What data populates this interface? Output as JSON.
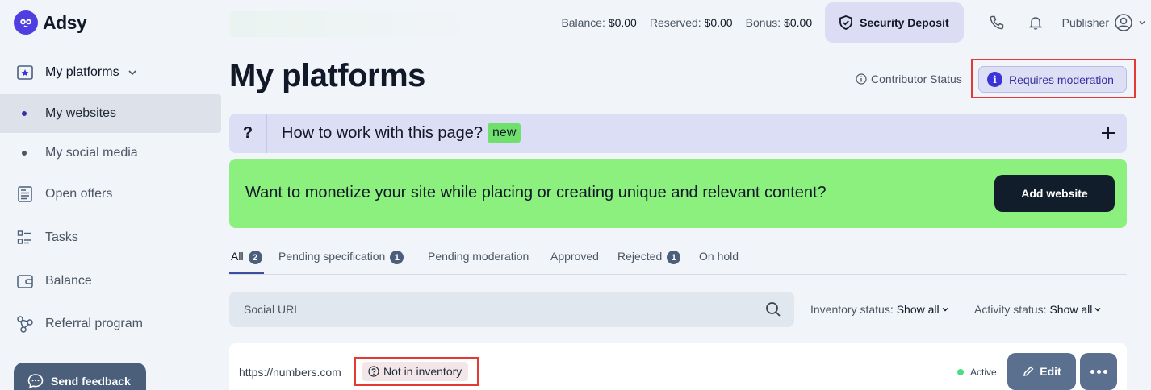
{
  "app": {
    "name": "Adsy"
  },
  "header": {
    "balance_label": "Balance:",
    "balance_value": "$0.00",
    "reserved_label": "Reserved:",
    "reserved_value": "$0.00",
    "bonus_label": "Bonus:",
    "bonus_value": "$0.00",
    "deposit_label": "Security Deposit",
    "user_label": "Publisher"
  },
  "sidebar": {
    "items": [
      {
        "label": "My platforms",
        "icon": "star-browser-icon"
      },
      {
        "label": "My websites"
      },
      {
        "label": "My social media"
      },
      {
        "label": "Open offers",
        "icon": "document-icon"
      },
      {
        "label": "Tasks",
        "icon": "checklist-icon"
      },
      {
        "label": "Balance",
        "icon": "wallet-icon"
      },
      {
        "label": "Referral program",
        "icon": "share-icon"
      }
    ],
    "feedback_label": "Send feedback"
  },
  "main": {
    "title": "My platforms",
    "contributor_label": "Contributor Status",
    "contributor_status": "Requires moderation",
    "howto": {
      "q": "?",
      "text": "How to work with this page?",
      "badge": "new"
    },
    "banner": {
      "text": "Want to monetize your site while placing or creating unique and relevant content?",
      "button": "Add website"
    },
    "tabs": [
      {
        "label": "All",
        "count": "2"
      },
      {
        "label": "Pending specification",
        "count": "1"
      },
      {
        "label": "Pending moderation"
      },
      {
        "label": "Approved"
      },
      {
        "label": "Rejected",
        "count": "1"
      },
      {
        "label": "On hold"
      }
    ],
    "search_placeholder": "Social URL",
    "inventory_label": "Inventory status:",
    "inventory_value": "Show all",
    "activity_label": "Activity status:",
    "activity_value": "Show all",
    "rows": [
      {
        "url": "https://numbers.com",
        "inventory": "Not in inventory",
        "status": "Active",
        "edit": "Edit"
      }
    ]
  },
  "colors": {
    "accent": "#3b34d9",
    "banner": "#8bf07e",
    "highlight": "#e53935"
  }
}
